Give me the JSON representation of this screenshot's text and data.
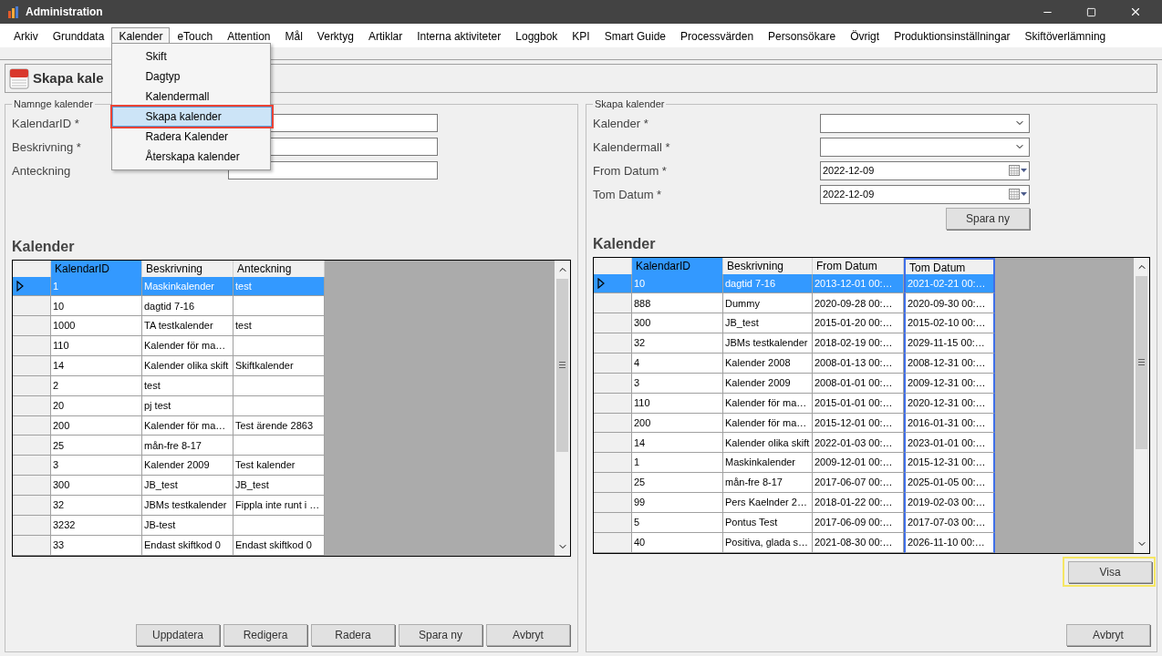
{
  "window": {
    "title": "Administration"
  },
  "menu": [
    {
      "label": "Arkiv",
      "selected": false
    },
    {
      "label": "Grunddata",
      "selected": false
    },
    {
      "label": "Kalender",
      "selected": true
    },
    {
      "label": "eTouch",
      "selected": false
    },
    {
      "label": "Attention",
      "selected": false
    },
    {
      "label": "Mål",
      "selected": false
    },
    {
      "label": "Verktyg",
      "selected": false
    },
    {
      "label": "Artiklar",
      "selected": false
    },
    {
      "label": "Interna aktiviteter",
      "selected": false
    },
    {
      "label": "Loggbok",
      "selected": false
    },
    {
      "label": "KPI",
      "selected": false
    },
    {
      "label": "Smart Guide",
      "selected": false
    },
    {
      "label": "Processvärden",
      "selected": false
    },
    {
      "label": "Personsökare",
      "selected": false
    },
    {
      "label": "Övrigt",
      "selected": false
    },
    {
      "label": "Produktionsinställningar",
      "selected": false
    },
    {
      "label": "Skiftöverlämning",
      "selected": false
    }
  ],
  "dropdown": [
    {
      "label": "Skift",
      "selected": false
    },
    {
      "label": "Dagtyp",
      "selected": false
    },
    {
      "label": "Kalendermall",
      "selected": false
    },
    {
      "label": "Skapa kalender",
      "selected": true
    },
    {
      "label": "Radera Kalender",
      "selected": false
    },
    {
      "label": "Återskapa kalender",
      "selected": false
    }
  ],
  "page_title": "Skapa kale",
  "left": {
    "legend": "Namnge kalender",
    "fields": [
      {
        "label": "KalendarID *"
      },
      {
        "label": "Beskrivning *"
      },
      {
        "label": "Anteckning"
      }
    ],
    "heading": "Kalender",
    "columns": [
      {
        "label": "KalendarID",
        "highlighted": true,
        "outlined": false
      },
      {
        "label": "Beskrivning",
        "highlighted": false,
        "outlined": false
      },
      {
        "label": "Anteckning",
        "highlighted": false,
        "outlined": false
      }
    ],
    "rows": [
      {
        "selected": true,
        "cells": [
          "1",
          "Maskinkalender",
          "test"
        ]
      },
      {
        "selected": false,
        "cells": [
          "10",
          "dagtid 7-16",
          ""
        ]
      },
      {
        "selected": false,
        "cells": [
          "1000",
          "TA testkalender",
          "test"
        ]
      },
      {
        "selected": false,
        "cells": [
          "110",
          "Kalender för ma…",
          ""
        ]
      },
      {
        "selected": false,
        "cells": [
          "14",
          "Kalender olika skift",
          "Skiftkalender"
        ]
      },
      {
        "selected": false,
        "cells": [
          "2",
          "test",
          ""
        ]
      },
      {
        "selected": false,
        "cells": [
          "20",
          "pj test",
          ""
        ]
      },
      {
        "selected": false,
        "cells": [
          "200",
          "Kalender för ma…",
          "Test ärende 2863"
        ]
      },
      {
        "selected": false,
        "cells": [
          "25",
          "mån-fre 8-17",
          ""
        ]
      },
      {
        "selected": false,
        "cells": [
          "3",
          "Kalender 2009",
          "Test kalender"
        ]
      },
      {
        "selected": false,
        "cells": [
          "300",
          "JB_test",
          "JB_test"
        ]
      },
      {
        "selected": false,
        "cells": [
          "32",
          "JBMs testkalender",
          "Fippla inte runt i …"
        ]
      },
      {
        "selected": false,
        "cells": [
          "3232",
          "JB-test",
          ""
        ]
      },
      {
        "selected": false,
        "cells": [
          "33",
          "Endast skiftkod 0",
          "Endast skiftkod 0"
        ]
      }
    ],
    "buttons": [
      "Uppdatera",
      "Redigera",
      "Radera",
      "Spara ny",
      "Avbryt"
    ]
  },
  "right": {
    "legend": "Skapa kalender",
    "fields": [
      {
        "label": "Kalender *",
        "kind": "combo"
      },
      {
        "label": "Kalendermall *",
        "kind": "combo"
      },
      {
        "label": "From Datum *",
        "kind": "date",
        "value": "2022-12-09"
      },
      {
        "label": "Tom Datum *",
        "kind": "date",
        "value": "2022-12-09"
      }
    ],
    "save_button": "Spara ny",
    "heading": "Kalender",
    "columns": [
      {
        "label": "KalendarID",
        "highlighted": true,
        "outlined": false
      },
      {
        "label": "Beskrivning",
        "highlighted": false,
        "outlined": false
      },
      {
        "label": "From Datum",
        "highlighted": false,
        "outlined": false
      },
      {
        "label": "Tom Datum",
        "highlighted": false,
        "outlined": true
      }
    ],
    "rows": [
      {
        "selected": true,
        "cells": [
          "10",
          "dagtid 7-16",
          "2013-12-01 00:…",
          "2021-02-21 00:…"
        ]
      },
      {
        "selected": false,
        "cells": [
          "888",
          "Dummy",
          "2020-09-28 00:…",
          "2020-09-30 00:…"
        ]
      },
      {
        "selected": false,
        "cells": [
          "300",
          "JB_test",
          "2015-01-20 00:…",
          "2015-02-10 00:…"
        ]
      },
      {
        "selected": false,
        "cells": [
          "32",
          "JBMs testkalender",
          "2018-02-19 00:…",
          "2029-11-15 00:…"
        ]
      },
      {
        "selected": false,
        "cells": [
          "4",
          "Kalender 2008",
          "2008-01-13 00:…",
          "2008-12-31 00:…"
        ]
      },
      {
        "selected": false,
        "cells": [
          "3",
          "Kalender 2009",
          "2008-01-01 00:…",
          "2009-12-31 00:…"
        ]
      },
      {
        "selected": false,
        "cells": [
          "110",
          "Kalender för ma…",
          "2015-01-01 00:…",
          "2020-12-31 00:…"
        ]
      },
      {
        "selected": false,
        "cells": [
          "200",
          "Kalender för ma…",
          "2015-12-01 00:…",
          "2016-01-31 00:…"
        ]
      },
      {
        "selected": false,
        "cells": [
          "14",
          "Kalender olika skift",
          "2022-01-03 00:…",
          "2023-01-01 00:…"
        ]
      },
      {
        "selected": false,
        "cells": [
          "1",
          "Maskinkalender",
          "2009-12-01 00:…",
          "2015-12-31 00:…"
        ]
      },
      {
        "selected": false,
        "cells": [
          "25",
          "mån-fre 8-17",
          "2017-06-07 00:…",
          "2025-01-05 00:…"
        ]
      },
      {
        "selected": false,
        "cells": [
          "99",
          "Pers Kaelnder 2…",
          "2018-01-22 00:…",
          "2019-02-03 00:…"
        ]
      },
      {
        "selected": false,
        "cells": [
          "5",
          "Pontus Test",
          "2017-06-09 00:…",
          "2017-07-03 00:…"
        ]
      },
      {
        "selected": false,
        "cells": [
          "40",
          "Positiva, glada s…",
          "2021-08-30 00:…",
          "2026-11-10 00:…"
        ]
      }
    ],
    "show_button": "Visa",
    "cancel_button": "Avbryt"
  }
}
